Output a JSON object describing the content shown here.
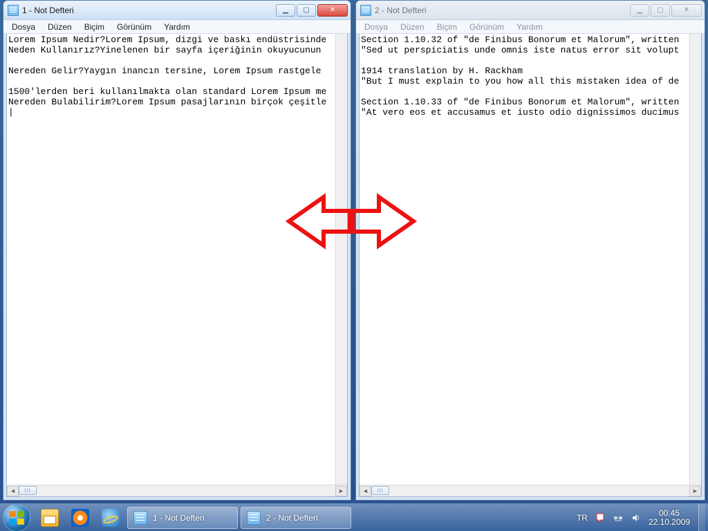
{
  "windows": [
    {
      "id": "w1",
      "title": "1 - Not Defteri",
      "active": true,
      "menus": [
        "Dosya",
        "Düzen",
        "Biçim",
        "Görünüm",
        "Yardım"
      ],
      "content": "Lorem Ipsum Nedir?Lorem Ipsum, dizgi ve baskı endüstrisinde\nNeden Kullanırız?Yinelenen bir sayfa içeriğinin okuyucunun \n\nNereden Gelir?Yaygın inancın tersine, Lorem Ipsum rastgele \n\n1500'lerden beri kullanılmakta olan standard Lorem Ipsum me\nNereden Bulabilirim?Lorem Ipsum pasajlarının birçok çeşitle\n|"
    },
    {
      "id": "w2",
      "title": "2 - Not Defteri",
      "active": false,
      "menus": [
        "Dosya",
        "Düzen",
        "Biçim",
        "Görünüm",
        "Yardım"
      ],
      "content": "Section 1.10.32 of \"de Finibus Bonorum et Malorum\", written\n\"Sed ut perspiciatis unde omnis iste natus error sit volupt\n\n1914 translation by H. Rackham\n\"But I must explain to you how all this mistaken idea of de\n\nSection 1.10.33 of \"de Finibus Bonorum et Malorum\", written\n\"At vero eos et accusamus et iusto odio dignissimos ducimus"
    }
  ],
  "taskbar": {
    "buttons": [
      {
        "label": "1 - Not Defteri"
      },
      {
        "label": "2 - Not Defteri"
      }
    ],
    "lang": "TR",
    "time": "00:45",
    "date": "22.10.2009"
  },
  "winbtn_glyphs": {
    "min": "▁",
    "max": "▢",
    "close": "✕"
  },
  "arrows": {
    "color": "#e11"
  }
}
